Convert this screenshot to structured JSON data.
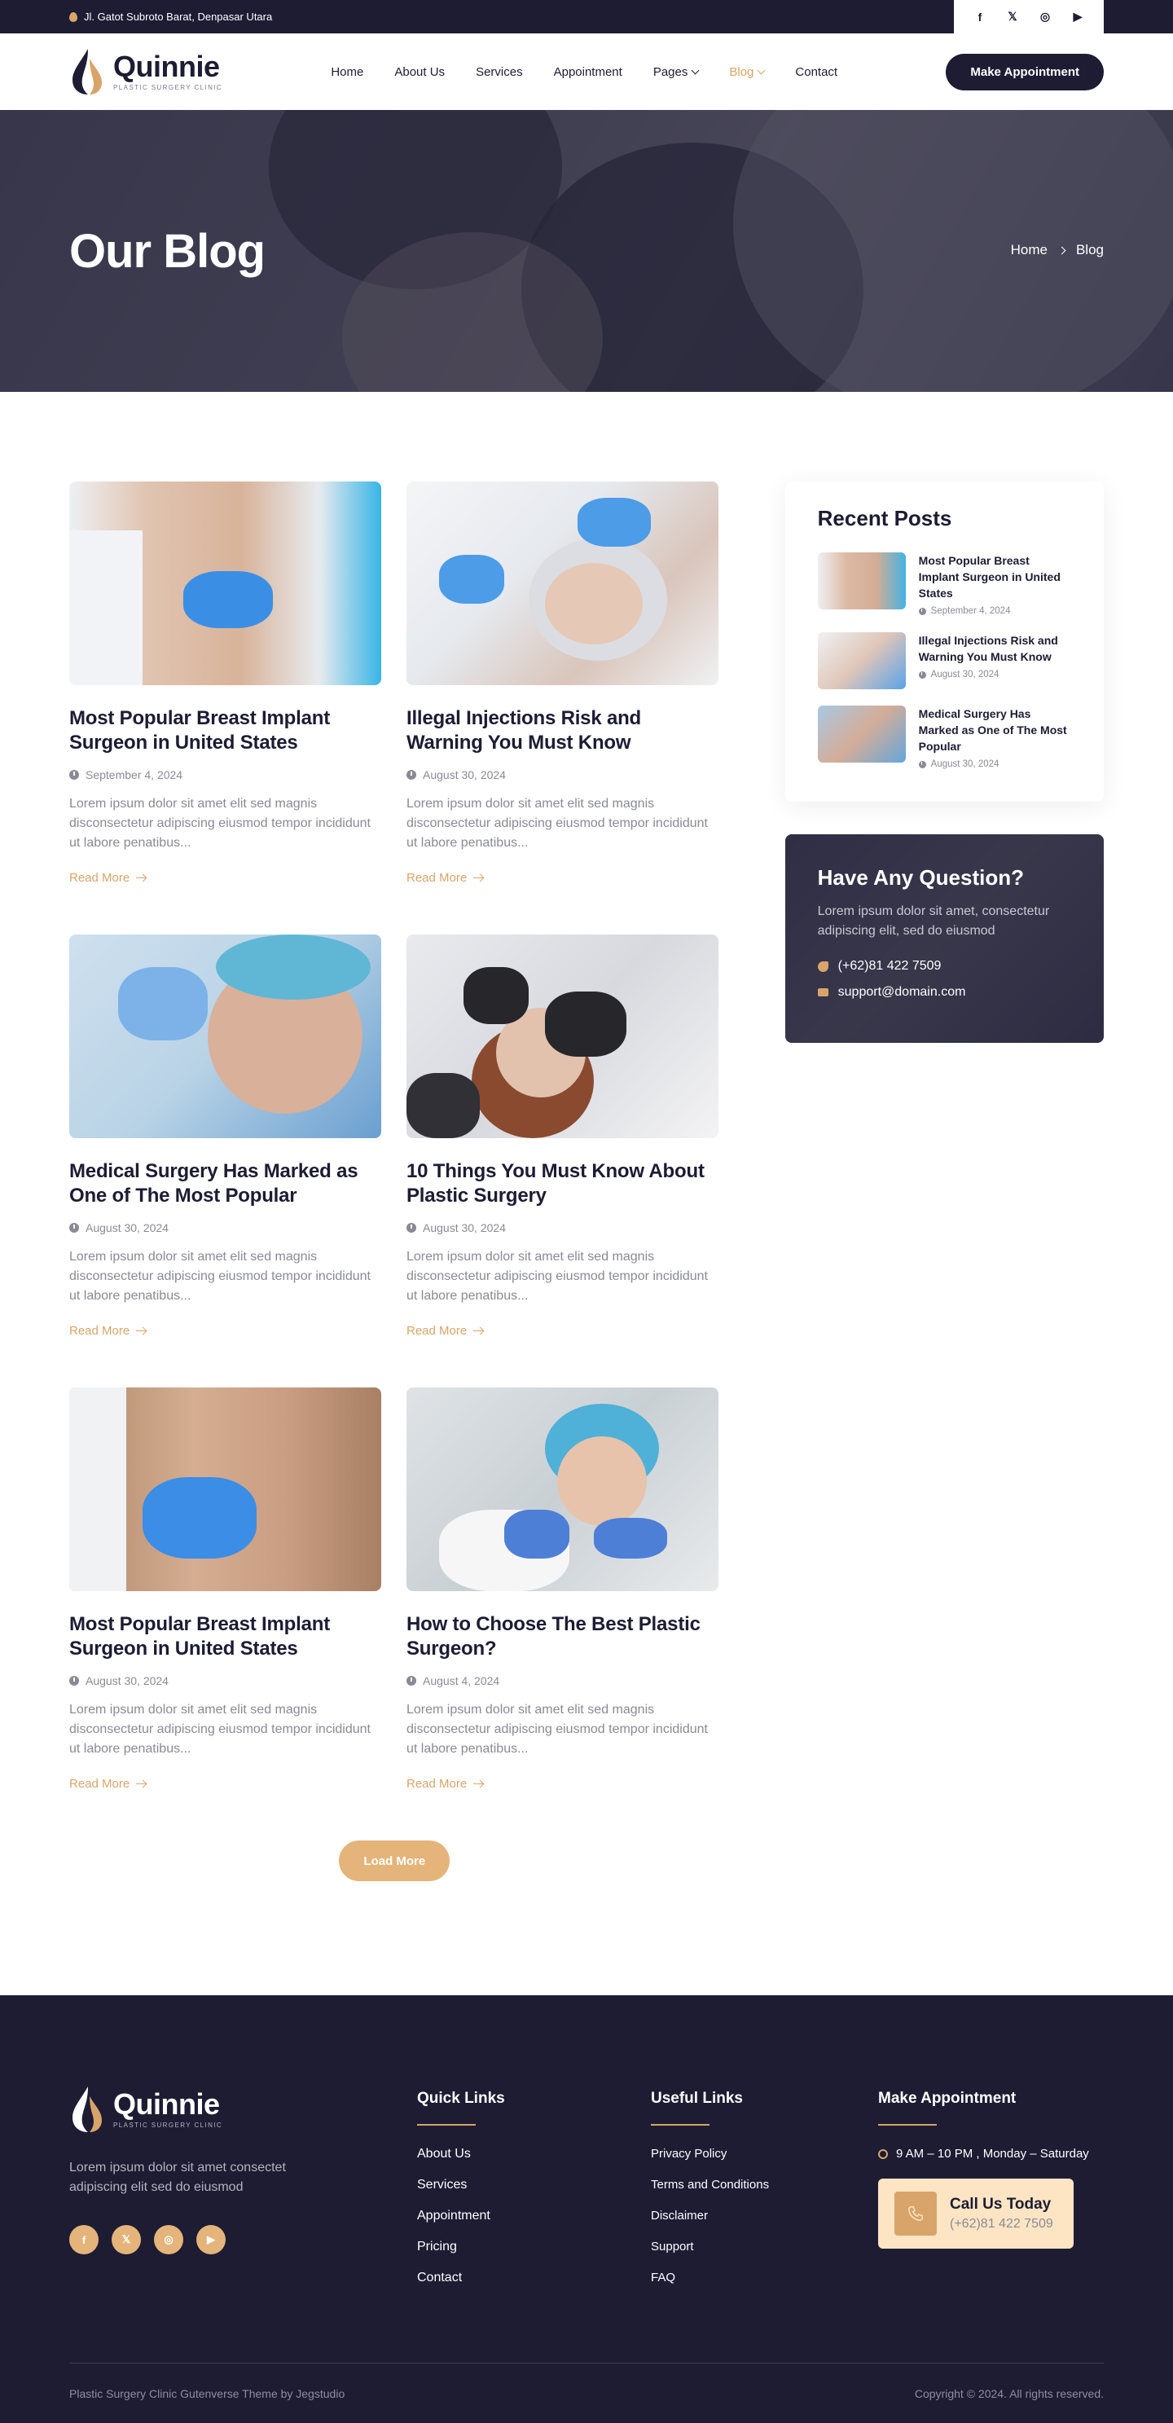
{
  "topbar": {
    "address": "Jl. Gatot Subroto Barat, Denpasar Utara",
    "socials": [
      "facebook-icon",
      "x-icon",
      "instagram-icon",
      "youtube-icon"
    ]
  },
  "header": {
    "logo_name": "Quinnie",
    "logo_tagline": "PLASTIC SURGERY CLINIC",
    "nav": {
      "home": "Home",
      "about": "About Us",
      "services": "Services",
      "appointment": "Appointment",
      "pages": "Pages",
      "blog": "Blog",
      "contact": "Contact"
    },
    "cta": "Make Appointment",
    "active_color": "#d8a46a"
  },
  "hero": {
    "title": "Our Blog",
    "breadcrumb_home": "Home",
    "breadcrumb_current": "Blog"
  },
  "posts": [
    {
      "title": "Most Popular Breast Implant Surgeon in United States",
      "date": "September 4, 2024",
      "excerpt": "Lorem ipsum dolor sit amet elit sed magnis disconsectetur adipiscing eiusmod tempor incididunt ut labore penatibus...",
      "read_more": "Read More"
    },
    {
      "title": "Illegal Injections Risk and Warning You Must Know",
      "date": "August 30, 2024",
      "excerpt": "Lorem ipsum dolor sit amet elit sed magnis disconsectetur adipiscing eiusmod tempor incididunt ut labore penatibus...",
      "read_more": "Read More"
    },
    {
      "title": "Medical Surgery Has Marked as One of The Most Popular",
      "date": "August 30, 2024",
      "excerpt": "Lorem ipsum dolor sit amet elit sed magnis disconsectetur adipiscing eiusmod tempor incididunt ut labore penatibus...",
      "read_more": "Read More"
    },
    {
      "title": "10 Things You Must Know About Plastic Surgery",
      "date": "August 30, 2024",
      "excerpt": "Lorem ipsum dolor sit amet elit sed magnis disconsectetur adipiscing eiusmod tempor incididunt ut labore penatibus...",
      "read_more": "Read More"
    },
    {
      "title": "Most Popular Breast Implant Surgeon in United States",
      "date": "August 30, 2024",
      "excerpt": "Lorem ipsum dolor sit amet elit sed magnis disconsectetur adipiscing eiusmod tempor incididunt ut labore penatibus...",
      "read_more": "Read More"
    },
    {
      "title": "How to Choose The Best Plastic Surgeon?",
      "date": "August 4, 2024",
      "excerpt": "Lorem ipsum dolor sit amet elit sed magnis disconsectetur adipiscing eiusmod tempor incididunt ut labore penatibus...",
      "read_more": "Read More"
    }
  ],
  "load_more": "Load More",
  "sidebar": {
    "recent_title": "Recent Posts",
    "recent": [
      {
        "title": "Most Popular Breast Implant Surgeon in United States",
        "date": "September 4, 2024"
      },
      {
        "title": "Illegal Injections Risk and Warning You Must Know",
        "date": "August 30, 2024"
      },
      {
        "title": "Medical Surgery Has Marked as One of The Most Popular",
        "date": "August 30, 2024"
      }
    ],
    "question_title": "Have Any Question?",
    "question_text": "Lorem ipsum dolor sit amet, consectetur adipiscing elit, sed do eiusmod",
    "phone": "(+62)81 422 7509",
    "email": "support@domain.com"
  },
  "footer": {
    "logo_name": "Quinnie",
    "logo_tagline": "PLASTIC SURGERY CLINIC",
    "desc": "Lorem ipsum dolor sit amet consectet adipiscing elit sed do eiusmod",
    "quick_title": "Quick Links",
    "quick": [
      "About Us",
      "Services",
      "Appointment",
      "Pricing",
      "Contact"
    ],
    "useful_title": "Useful Links",
    "useful": [
      "Privacy Policy",
      "Terms and Conditions",
      "Disclaimer",
      "Support",
      "FAQ"
    ],
    "appt_title": "Make Appointment",
    "hours": "9 AM – 10 PM , Monday – Saturday",
    "call_title": "Call Us Today",
    "call_phone": "(+62)81 422 7509",
    "theme_credit": "Plastic Surgery Clinic Gutenverse Theme by Jegstudio",
    "copyright": "Copyright © 2024. All rights reserved."
  }
}
